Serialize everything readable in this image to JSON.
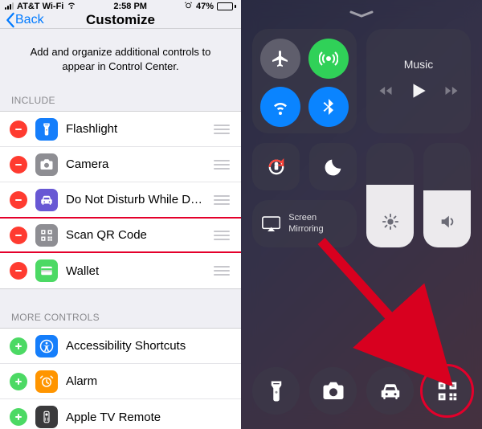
{
  "statusbar": {
    "carrier": "AT&T Wi-Fi",
    "time": "2:58 PM",
    "battery_pct": "47%",
    "battery_fill_pct": 47
  },
  "navbar": {
    "back": "Back",
    "title": "Customize"
  },
  "description": "Add and organize additional controls to appear in Control Center.",
  "sections": {
    "include": "INCLUDE",
    "more": "MORE CONTROLS"
  },
  "include": [
    {
      "label": "Flashlight",
      "icon": "flashlight",
      "bg": "bg-blue"
    },
    {
      "label": "Camera",
      "icon": "camera",
      "bg": "bg-gray"
    },
    {
      "label": "Do Not Disturb While Driving",
      "icon": "car",
      "bg": "bg-purple"
    },
    {
      "label": "Scan QR Code",
      "icon": "qr",
      "bg": "bg-gray",
      "highlighted": true
    },
    {
      "label": "Wallet",
      "icon": "wallet",
      "bg": "bg-green"
    }
  ],
  "more": [
    {
      "label": "Accessibility Shortcuts",
      "icon": "accessibility",
      "bg": "bg-blue"
    },
    {
      "label": "Alarm",
      "icon": "alarm",
      "bg": "bg-orange"
    },
    {
      "label": "Apple TV Remote",
      "icon": "remote",
      "bg": "bg-dark"
    }
  ],
  "control_center": {
    "music_title": "Music",
    "screen_mirroring": "Screen Mirroring",
    "brightness_fill_pct": 60,
    "volume_fill_pct": 55,
    "bottom": [
      "flashlight",
      "camera",
      "car",
      "qr"
    ],
    "highlighted_bottom_index": 3
  }
}
